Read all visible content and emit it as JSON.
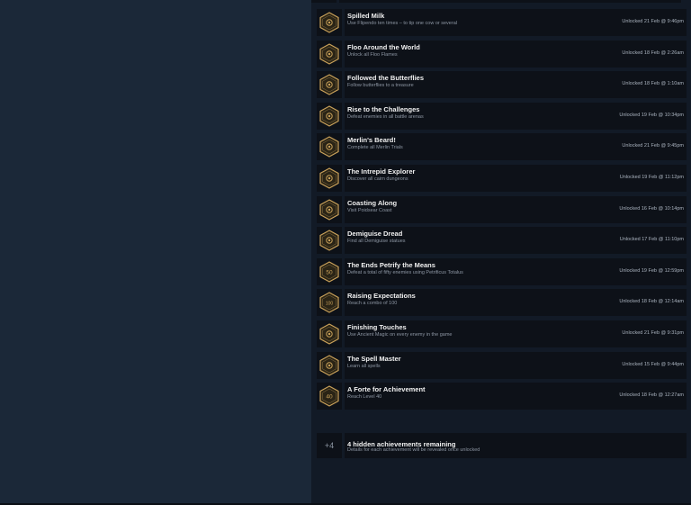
{
  "achievements": [
    {
      "title": "Spilled Milk",
      "desc": "Use Flipendo ten times – to tip one cow or several",
      "date": "Unlocked 21 Feb @ 9:46pm",
      "icon": "swirl-icon"
    },
    {
      "title": "Floo Around the World",
      "desc": "Unlock all Floo Flames",
      "date": "Unlocked 18 Feb @ 2:26am",
      "icon": "flame-icon"
    },
    {
      "title": "Followed the Butterflies",
      "desc": "Follow butterflies to a treasure",
      "date": "Unlocked 18 Feb @ 1:10am",
      "icon": "butterfly-icon"
    },
    {
      "title": "Rise to the Challenges",
      "desc": "Defeat enemies in all battle arenas",
      "date": "Unlocked 19 Feb @ 10:34pm",
      "icon": "arena-icon"
    },
    {
      "title": "Merlin's Beard!",
      "desc": "Complete all Merlin Trials",
      "date": "Unlocked 21 Feb @ 9:45pm",
      "icon": "beard-icon"
    },
    {
      "title": "The Intrepid Explorer",
      "desc": "Discover all cairn dungeons",
      "date": "Unlocked 19 Feb @ 11:12pm",
      "icon": "dungeon-icon"
    },
    {
      "title": "Coasting Along",
      "desc": "Visit Poidsear Coast",
      "date": "Unlocked 16 Feb @ 10:14pm",
      "icon": "coast-icon"
    },
    {
      "title": "Demiguise Dread",
      "desc": "Find all Demiguise statues",
      "date": "Unlocked 17 Feb @ 11:10pm",
      "icon": "statue-icon"
    },
    {
      "title": "The Ends Petrify the Means",
      "desc": "Defeat a total of fifty enemies using Petrificus Totalus",
      "date": "Unlocked 19 Feb @ 12:59pm",
      "icon": "badge-50-icon",
      "badge": "50"
    },
    {
      "title": "Raising Expectations",
      "desc": "Reach a combo of 100",
      "date": "Unlocked 18 Feb @ 12:14am",
      "icon": "badge-100-icon",
      "badge": "100"
    },
    {
      "title": "Finishing Touches",
      "desc": "Use Ancient Magic on every enemy in the game",
      "date": "Unlocked 21 Feb @ 9:31pm",
      "icon": "ancient-magic-icon"
    },
    {
      "title": "The Spell Master",
      "desc": "Learn all spells",
      "date": "Unlocked 15 Feb @ 9:44pm",
      "icon": "spell-icon"
    },
    {
      "title": "A Forte for Achievement",
      "desc": "Reach Level 40",
      "date": "Unlocked 18 Feb @ 12:27am",
      "icon": "level-40-icon",
      "badge": "40"
    }
  ],
  "hidden": {
    "count_label": "+4",
    "title": "4 hidden achievements remaining",
    "desc": "Details for each achievement will be revealed once unlocked"
  },
  "colors": {
    "gold": "#c9a15a",
    "hex_fill": "#2a2416"
  }
}
